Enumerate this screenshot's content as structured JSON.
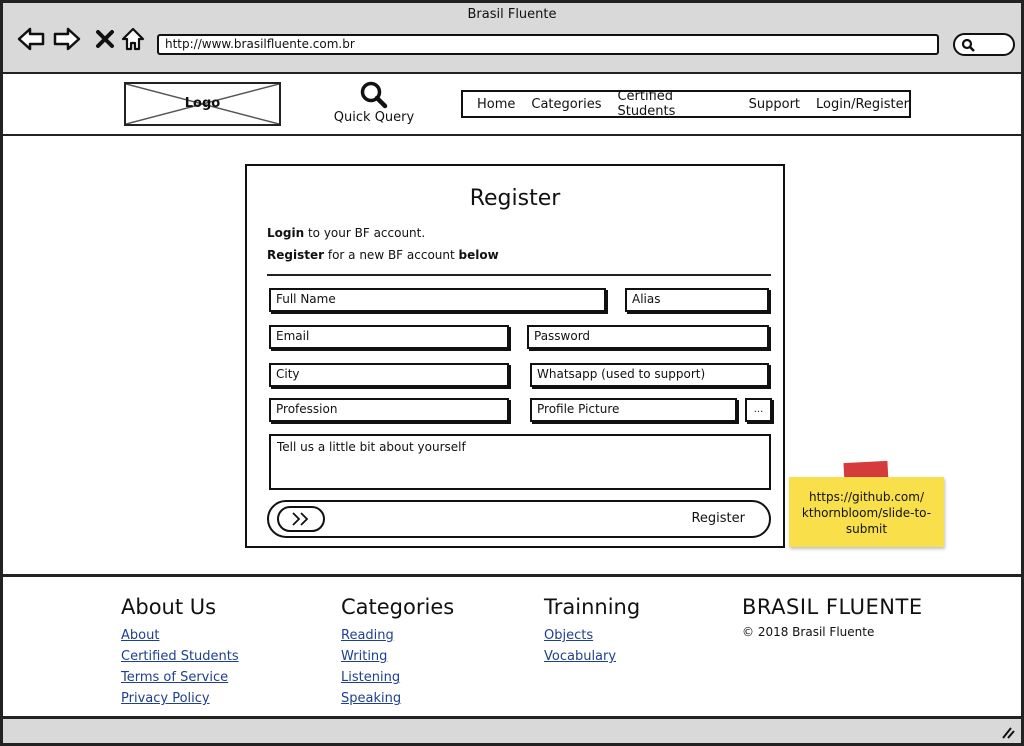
{
  "window": {
    "title": "Brasil Fluente",
    "url": "http://www.brasilfluente.com.br"
  },
  "header": {
    "logo_text": "Logo",
    "quick_query": "Quick Query",
    "nav": [
      "Home",
      "Categories",
      "Certified Students",
      "Support",
      "Login/Register"
    ]
  },
  "form": {
    "title": "Register",
    "login_bold": "Login",
    "login_rest": " to your BF account.",
    "register_bold": "Register",
    "register_mid": " for a new BF account ",
    "register_bold2": "below",
    "full_name": "Full Name",
    "alias": "Alias",
    "email": "Email",
    "password": "Password",
    "city": "City",
    "whatsapp": "Whatsapp (used to support)",
    "profession": "Profession",
    "profile_picture": "Profile Picture",
    "browse": "...",
    "about": "Tell us a little bit about yourself",
    "submit": "Register"
  },
  "sticky_note": "https://github.com/ kthornbloom/slide-to- submit",
  "footer": {
    "about": {
      "title": "About Us",
      "links": [
        "About",
        "Certified Students",
        "Terms of Service",
        "Privacy Policy"
      ]
    },
    "categories": {
      "title": "Categories",
      "links": [
        "Reading",
        "Writing",
        "Listening",
        "Speaking"
      ]
    },
    "training": {
      "title": "Trainning",
      "links": [
        "Objects",
        "Vocabulary"
      ]
    },
    "brand": {
      "title": "BRASIL FLUENTE",
      "copyright": "© 2018 Brasil Fluente"
    }
  },
  "icons": [
    "back-icon",
    "forward-icon",
    "close-icon",
    "home-icon",
    "search-icon",
    "chevron-double-right-icon",
    "resize-grip-icon"
  ]
}
